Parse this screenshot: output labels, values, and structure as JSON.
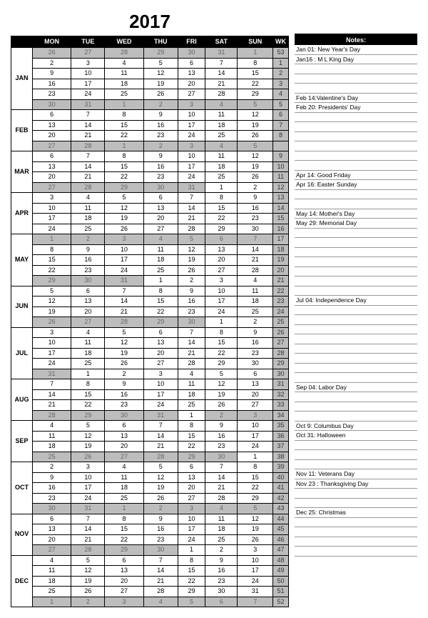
{
  "year": "2017",
  "headers": [
    "MON",
    "TUE",
    "WED",
    "THU",
    "FRI",
    "SAT",
    "SUN",
    "WK"
  ],
  "notes_header": "Notes:",
  "months": [
    {
      "label": "JAN",
      "rows": [
        {
          "d": [
            26,
            27,
            28,
            29,
            30,
            31,
            1
          ],
          "s": [
            1,
            1,
            1,
            1,
            1,
            1,
            1
          ],
          "wk": 53
        },
        {
          "d": [
            2,
            3,
            4,
            5,
            6,
            7,
            8
          ],
          "s": [
            0,
            0,
            0,
            0,
            0,
            0,
            0
          ],
          "wk": 1
        },
        {
          "d": [
            9,
            10,
            11,
            12,
            13,
            14,
            15
          ],
          "s": [
            0,
            0,
            0,
            0,
            0,
            0,
            0
          ],
          "wk": 2
        },
        {
          "d": [
            16,
            17,
            18,
            19,
            20,
            21,
            22
          ],
          "s": [
            0,
            0,
            0,
            0,
            0,
            0,
            0
          ],
          "wk": 3
        },
        {
          "d": [
            23,
            24,
            25,
            26,
            27,
            28,
            29
          ],
          "s": [
            0,
            0,
            0,
            0,
            0,
            0,
            0
          ],
          "wk": 4
        },
        {
          "d": [
            30,
            31,
            1,
            2,
            3,
            4,
            5
          ],
          "s": [
            1,
            1,
            1,
            1,
            1,
            1,
            1
          ],
          "wk": 5
        }
      ]
    },
    {
      "label": "FEB",
      "rows": [
        {
          "d": [
            6,
            7,
            8,
            9,
            10,
            11,
            12
          ],
          "s": [
            0,
            0,
            0,
            0,
            0,
            0,
            0
          ],
          "wk": 6
        },
        {
          "d": [
            13,
            14,
            15,
            16,
            17,
            18,
            19
          ],
          "s": [
            0,
            0,
            0,
            0,
            0,
            0,
            0
          ],
          "wk": 7
        },
        {
          "d": [
            20,
            21,
            22,
            23,
            24,
            25,
            26
          ],
          "s": [
            0,
            0,
            0,
            0,
            0,
            0,
            0
          ],
          "wk": 8
        },
        {
          "d": [
            27,
            28,
            1,
            2,
            3,
            4,
            5
          ],
          "s": [
            1,
            1,
            1,
            1,
            1,
            1,
            1
          ],
          "wk": ""
        }
      ]
    },
    {
      "label": "MAR",
      "rows": [
        {
          "d": [
            6,
            7,
            8,
            9,
            10,
            11,
            12
          ],
          "s": [
            0,
            0,
            0,
            0,
            0,
            0,
            0
          ],
          "wk": 9
        },
        {
          "d": [
            13,
            14,
            15,
            16,
            17,
            18,
            19
          ],
          "s": [
            0,
            0,
            0,
            0,
            0,
            0,
            0
          ],
          "wk": 10
        },
        {
          "d": [
            20,
            21,
            22,
            23,
            24,
            25,
            26
          ],
          "s": [
            0,
            0,
            0,
            0,
            0,
            0,
            0
          ],
          "wk": 11
        },
        {
          "d": [
            27,
            28,
            29,
            30,
            31,
            1,
            2
          ],
          "s": [
            1,
            1,
            1,
            1,
            1,
            0,
            0
          ],
          "wk": 12
        }
      ]
    },
    {
      "label": "APR",
      "rows": [
        {
          "d": [
            3,
            4,
            5,
            6,
            7,
            8,
            9
          ],
          "s": [
            0,
            0,
            0,
            0,
            0,
            0,
            0
          ],
          "wk": 13
        },
        {
          "d": [
            10,
            11,
            12,
            13,
            14,
            15,
            16
          ],
          "s": [
            0,
            0,
            0,
            0,
            0,
            0,
            0
          ],
          "wk": 14
        },
        {
          "d": [
            17,
            18,
            19,
            20,
            21,
            22,
            23
          ],
          "s": [
            0,
            0,
            0,
            0,
            0,
            0,
            0
          ],
          "wk": 15
        },
        {
          "d": [
            24,
            25,
            26,
            27,
            28,
            29,
            30
          ],
          "s": [
            0,
            0,
            0,
            0,
            0,
            0,
            0
          ],
          "wk": 16
        }
      ]
    },
    {
      "label": "MAY",
      "rows": [
        {
          "d": [
            1,
            2,
            3,
            4,
            5,
            6,
            7
          ],
          "s": [
            1,
            1,
            1,
            1,
            1,
            1,
            1
          ],
          "wk": 17
        },
        {
          "d": [
            8,
            9,
            10,
            11,
            12,
            13,
            14
          ],
          "s": [
            0,
            0,
            0,
            0,
            0,
            0,
            0
          ],
          "wk": 18
        },
        {
          "d": [
            15,
            16,
            17,
            18,
            19,
            20,
            21
          ],
          "s": [
            0,
            0,
            0,
            0,
            0,
            0,
            0
          ],
          "wk": 19
        },
        {
          "d": [
            22,
            23,
            24,
            25,
            26,
            27,
            28
          ],
          "s": [
            0,
            0,
            0,
            0,
            0,
            0,
            0
          ],
          "wk": 20
        },
        {
          "d": [
            29,
            30,
            31,
            1,
            2,
            3,
            4
          ],
          "s": [
            1,
            1,
            1,
            0,
            0,
            0,
            0
          ],
          "wk": 21
        }
      ]
    },
    {
      "label": "JUN",
      "rows": [
        {
          "d": [
            5,
            6,
            7,
            8,
            9,
            10,
            11
          ],
          "s": [
            0,
            0,
            0,
            0,
            0,
            0,
            0
          ],
          "wk": 22
        },
        {
          "d": [
            12,
            13,
            14,
            15,
            16,
            17,
            18
          ],
          "s": [
            0,
            0,
            0,
            0,
            0,
            0,
            0
          ],
          "wk": 23
        },
        {
          "d": [
            19,
            20,
            21,
            22,
            23,
            24,
            25
          ],
          "s": [
            0,
            0,
            0,
            0,
            0,
            0,
            0
          ],
          "wk": 24
        },
        {
          "d": [
            26,
            27,
            28,
            29,
            30,
            1,
            2
          ],
          "s": [
            1,
            1,
            1,
            1,
            1,
            0,
            0
          ],
          "wk": 25
        }
      ]
    },
    {
      "label": "JUL",
      "rows": [
        {
          "d": [
            3,
            4,
            5,
            6,
            7,
            8,
            9
          ],
          "s": [
            0,
            0,
            0,
            0,
            0,
            0,
            0
          ],
          "wk": 26
        },
        {
          "d": [
            10,
            11,
            12,
            13,
            14,
            15,
            16
          ],
          "s": [
            0,
            0,
            0,
            0,
            0,
            0,
            0
          ],
          "wk": 27
        },
        {
          "d": [
            17,
            18,
            19,
            20,
            21,
            22,
            23
          ],
          "s": [
            0,
            0,
            0,
            0,
            0,
            0,
            0
          ],
          "wk": 28
        },
        {
          "d": [
            24,
            25,
            26,
            27,
            28,
            29,
            30
          ],
          "s": [
            0,
            0,
            0,
            0,
            0,
            0,
            0
          ],
          "wk": 29
        },
        {
          "d": [
            31,
            1,
            2,
            3,
            4,
            5,
            6
          ],
          "s": [
            1,
            0,
            0,
            0,
            0,
            0,
            0
          ],
          "wk": 30
        }
      ]
    },
    {
      "label": "AUG",
      "rows": [
        {
          "d": [
            7,
            8,
            9,
            10,
            11,
            12,
            13
          ],
          "s": [
            0,
            0,
            0,
            0,
            0,
            0,
            0
          ],
          "wk": 31
        },
        {
          "d": [
            14,
            15,
            16,
            17,
            18,
            19,
            20
          ],
          "s": [
            0,
            0,
            0,
            0,
            0,
            0,
            0
          ],
          "wk": 32
        },
        {
          "d": [
            21,
            22,
            23,
            24,
            25,
            26,
            27
          ],
          "s": [
            0,
            0,
            0,
            0,
            0,
            0,
            0
          ],
          "wk": 33
        },
        {
          "d": [
            28,
            29,
            30,
            31,
            1,
            2,
            3
          ],
          "s": [
            1,
            1,
            1,
            1,
            0,
            1,
            1
          ],
          "wk": 34
        }
      ]
    },
    {
      "label": "SEP",
      "rows": [
        {
          "d": [
            4,
            5,
            6,
            7,
            8,
            9,
            10
          ],
          "s": [
            0,
            0,
            0,
            0,
            0,
            0,
            0
          ],
          "wk": 35
        },
        {
          "d": [
            11,
            12,
            13,
            14,
            15,
            16,
            17
          ],
          "s": [
            0,
            0,
            0,
            0,
            0,
            0,
            0
          ],
          "wk": 36
        },
        {
          "d": [
            18,
            19,
            20,
            21,
            22,
            23,
            24
          ],
          "s": [
            0,
            0,
            0,
            0,
            0,
            0,
            0
          ],
          "wk": 37
        },
        {
          "d": [
            25,
            26,
            27,
            28,
            29,
            30,
            1
          ],
          "s": [
            1,
            1,
            1,
            1,
            1,
            1,
            0
          ],
          "wk": 38
        }
      ]
    },
    {
      "label": "OCT",
      "rows": [
        {
          "d": [
            2,
            3,
            4,
            5,
            6,
            7,
            8
          ],
          "s": [
            0,
            0,
            0,
            0,
            0,
            0,
            0
          ],
          "wk": 39
        },
        {
          "d": [
            9,
            10,
            11,
            12,
            13,
            14,
            15
          ],
          "s": [
            0,
            0,
            0,
            0,
            0,
            0,
            0
          ],
          "wk": 40
        },
        {
          "d": [
            16,
            17,
            18,
            19,
            20,
            21,
            22
          ],
          "s": [
            0,
            0,
            0,
            0,
            0,
            0,
            0
          ],
          "wk": 41
        },
        {
          "d": [
            23,
            24,
            25,
            26,
            27,
            28,
            29
          ],
          "s": [
            0,
            0,
            0,
            0,
            0,
            0,
            0
          ],
          "wk": 42
        },
        {
          "d": [
            30,
            31,
            1,
            2,
            3,
            4,
            5
          ],
          "s": [
            1,
            1,
            1,
            1,
            1,
            1,
            1
          ],
          "wk": 43
        }
      ]
    },
    {
      "label": "NOV",
      "rows": [
        {
          "d": [
            6,
            7,
            8,
            9,
            10,
            11,
            12
          ],
          "s": [
            0,
            0,
            0,
            0,
            0,
            0,
            0
          ],
          "wk": 44
        },
        {
          "d": [
            13,
            14,
            15,
            16,
            17,
            18,
            19
          ],
          "s": [
            0,
            0,
            0,
            0,
            0,
            0,
            0
          ],
          "wk": 45
        },
        {
          "d": [
            20,
            21,
            22,
            23,
            24,
            25,
            26
          ],
          "s": [
            0,
            0,
            0,
            0,
            0,
            0,
            0
          ],
          "wk": 46
        },
        {
          "d": [
            27,
            28,
            29,
            30,
            1,
            2,
            3
          ],
          "s": [
            1,
            1,
            1,
            1,
            0,
            0,
            0
          ],
          "wk": 47
        }
      ]
    },
    {
      "label": "DEC",
      "rows": [
        {
          "d": [
            4,
            5,
            6,
            7,
            8,
            9,
            10
          ],
          "s": [
            0,
            0,
            0,
            0,
            0,
            0,
            0
          ],
          "wk": 48
        },
        {
          "d": [
            11,
            12,
            13,
            14,
            15,
            16,
            17
          ],
          "s": [
            0,
            0,
            0,
            0,
            0,
            0,
            0
          ],
          "wk": 49
        },
        {
          "d": [
            18,
            19,
            20,
            21,
            22,
            23,
            24
          ],
          "s": [
            0,
            0,
            0,
            0,
            0,
            0,
            0
          ],
          "wk": 50
        },
        {
          "d": [
            25,
            26,
            27,
            28,
            29,
            30,
            31
          ],
          "s": [
            0,
            0,
            0,
            0,
            0,
            0,
            0
          ],
          "wk": 51
        },
        {
          "d": [
            1,
            2,
            3,
            4,
            5,
            6,
            7
          ],
          "s": [
            1,
            1,
            1,
            1,
            1,
            1,
            1
          ],
          "wk": 52
        }
      ]
    }
  ],
  "notes": [
    "Jan 01: New Year's Day",
    "Jan16 : M L King Day",
    "",
    "",
    "",
    "Feb 14:Valentine's Day",
    "Feb 20: Presidents' Day",
    "",
    "",
    "",
    "",
    "",
    "",
    "Apr 14: Good Friday",
    "Apr 16: Easter Sunday",
    "",
    "",
    "May 14: Mother's Day",
    "May 29: Memorial Day",
    "",
    "",
    "",
    "",
    "",
    "",
    "",
    "Jul 04: Independence Day",
    "",
    "",
    "",
    "",
    "",
    "",
    "",
    "",
    "Sep 04: Labor Day",
    "",
    "",
    "",
    "Oct 9: Columbus Day",
    "Oct 31: Halloween",
    "",
    "",
    "",
    "Nov 11: Veterans Day",
    "Nov 23 : Thanksgiving Day",
    "",
    "",
    "Dec 25: Christmas",
    "",
    "",
    "",
    ""
  ]
}
